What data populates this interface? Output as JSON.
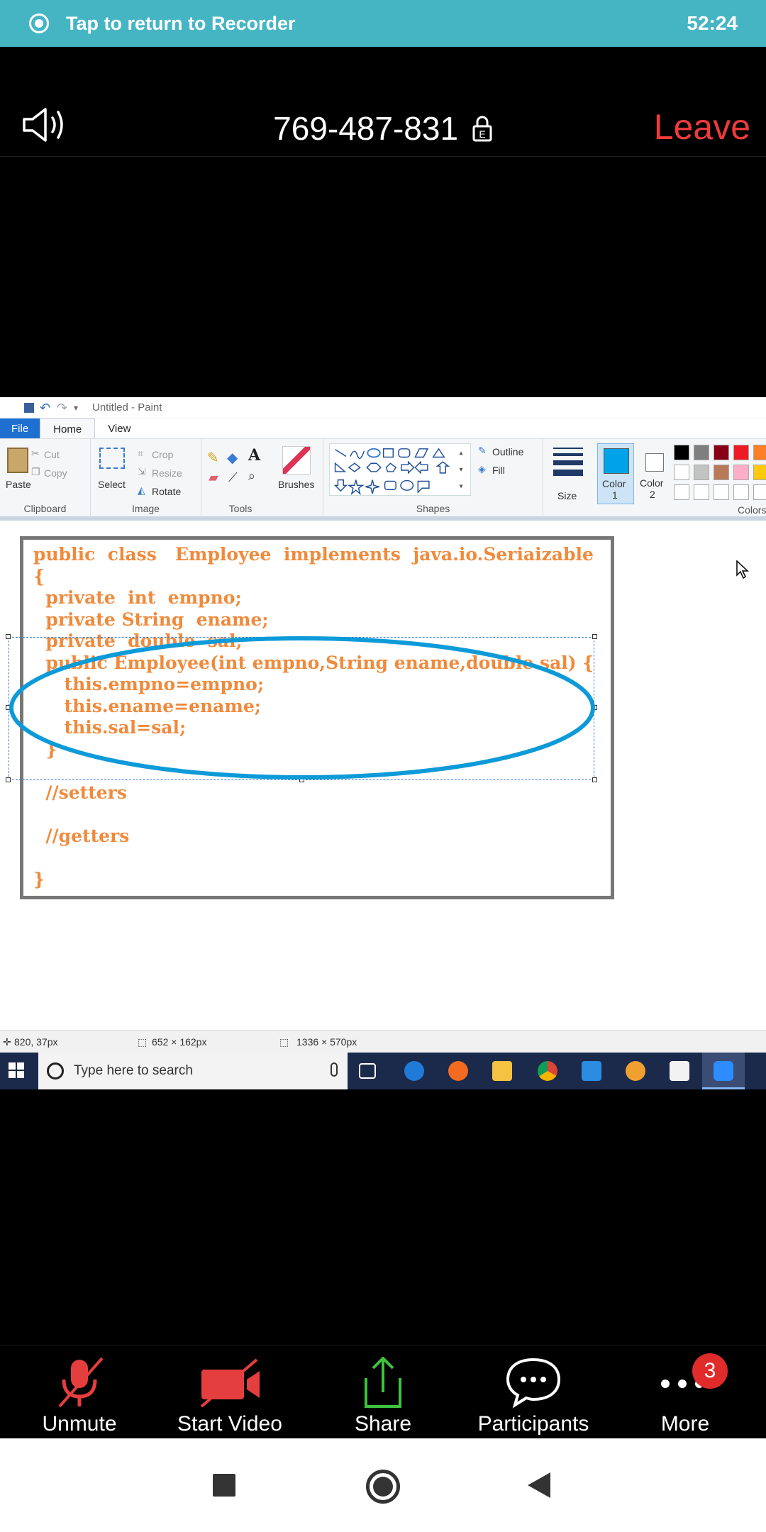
{
  "banner": {
    "text": "Tap to return to Recorder",
    "time": "52:24"
  },
  "meeting": {
    "id": "769-487-831",
    "leave_label": "Leave",
    "lock_letter": "E"
  },
  "paint": {
    "window_title": "Untitled - Paint",
    "menu": {
      "file": "File",
      "home": "Home",
      "view": "View"
    },
    "clipboard": {
      "paste": "Paste",
      "cut": "Cut",
      "copy": "Copy",
      "label": "Clipboard"
    },
    "image": {
      "select": "Select",
      "crop": "Crop",
      "resize": "Resize",
      "rotate": "Rotate",
      "label": "Image"
    },
    "tools": {
      "label": "Tools",
      "brushes": "Brushes"
    },
    "shapes": {
      "outline": "Outline",
      "fill": "Fill",
      "label": "Shapes"
    },
    "size_label": "Size",
    "color1": {
      "line1": "Color",
      "line2": "1"
    },
    "color2": {
      "line1": "Color",
      "line2": "2"
    },
    "colors_label": "Colors",
    "palette": [
      "#000000",
      "#7f7f7f",
      "#880015",
      "#ed1c24",
      "#ff7f27",
      "#ffffff",
      "#c3c3c3",
      "#b97a57",
      "#ffaec9",
      "#ffc90e",
      "#ffffff",
      "#ffffff",
      "#ffffff",
      "#ffffff",
      "#ffffff"
    ],
    "code_lines": [
      "public  class   Employee  implements  java.io.Seriaizable",
      "{",
      "  private  int  empno;",
      "  private String  ename;",
      "  private  double  sal;",
      "  public Employee(int empno,String ename,double sal) {",
      "     this.empno=empno;",
      "     this.ename=ename;",
      "     this.sal=sal;",
      "  }",
      "",
      "  //setters",
      "",
      "  //getters",
      "",
      "}"
    ],
    "status": {
      "cursor_pos": "820, 37px",
      "selection_size": "652 × 162px",
      "canvas_size": "1336 × 570px"
    },
    "taskbar": {
      "search_placeholder": "Type here to search"
    }
  },
  "toolbar": {
    "unmute": "Unmute",
    "start_video": "Start Video",
    "share": "Share",
    "participants": "Participants",
    "more": "More",
    "more_badge": "3"
  }
}
